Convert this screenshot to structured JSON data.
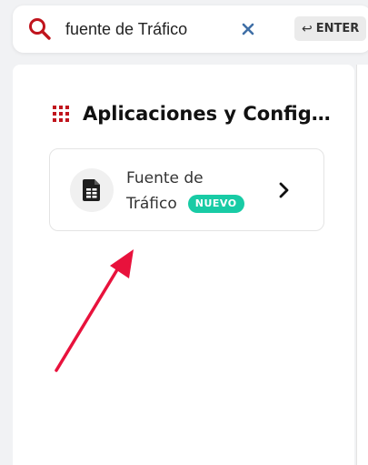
{
  "search": {
    "query": "fuente de Tráfico",
    "enter_label": "ENTER",
    "enter_glyph": "↩"
  },
  "section": {
    "title": "Aplicaciones y Configuración"
  },
  "result": {
    "title_line1": "Fuente de",
    "title_line2": "Tráfico",
    "badge": "NUEVO"
  },
  "icons": {
    "search": "search-icon",
    "clear": "close-icon",
    "section": "apps-grid-icon",
    "result": "document-icon",
    "chevron": "chevron-right-icon"
  },
  "colors": {
    "accent_red": "#c0141d",
    "clear_blue": "#3f6fa6",
    "badge_green": "#18cba5",
    "annotation_arrow": "#e8123c"
  }
}
